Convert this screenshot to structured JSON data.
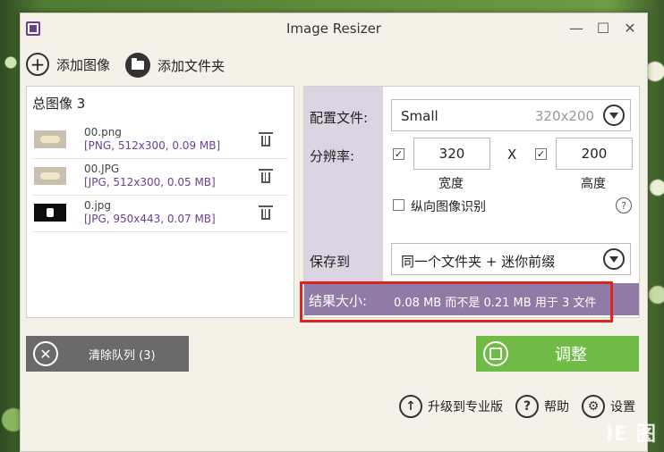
{
  "window": {
    "title": "Image Resizer",
    "minimize": "—",
    "maximize": "☐",
    "close": "✕"
  },
  "toolbar": {
    "add_image": "添加图像",
    "add_folder": "添加文件夹"
  },
  "files": {
    "count_label": "总图像 3",
    "items": [
      {
        "name": "00.png",
        "meta": "[PNG, 512x300, 0.09 MB]"
      },
      {
        "name": "00.JPG",
        "meta": "[JPG, 512x300, 0.05 MB]"
      },
      {
        "name": "0.jpg",
        "meta": "[JPG, 950x443, 0.07 MB]"
      }
    ]
  },
  "settings": {
    "profile_label": "配置文件:",
    "profile_value": "Small",
    "profile_size": "320x200",
    "resolution_label": "分辨率:",
    "width_value": "320",
    "height_value": "200",
    "x_sep": "X",
    "width_label": "宽度",
    "height_label": "高度",
    "check_mark": "✓",
    "portrait_label": "纵向图像识别",
    "help": "?",
    "save_label": "保存到",
    "save_value": "同一个文件夹 + 迷你前缀",
    "result_label": "结果大小:",
    "result_text": "0.08 MB 而不是 0.21 MB 用于 3 文件"
  },
  "actions": {
    "clear_label": "清除队列 (3)",
    "adjust_label": "调整"
  },
  "footer": {
    "upgrade": "升级到专业版",
    "help": "帮助",
    "settings": "设置"
  },
  "watermark": "IE 图"
}
